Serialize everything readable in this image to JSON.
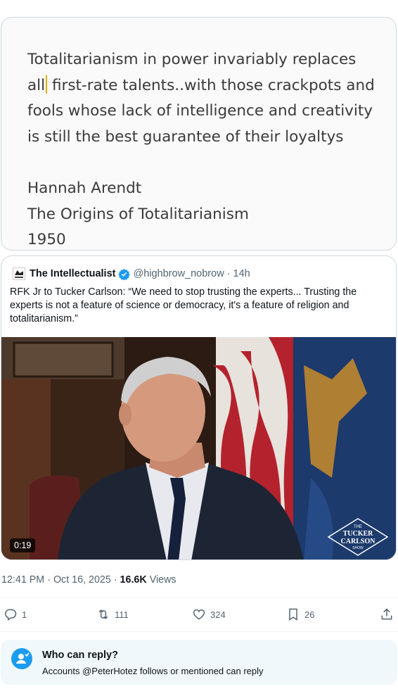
{
  "quote_card": {
    "lines": [
      "Totalitarianism in power invariably replaces",
      "first-rate talents..with those crackpots and",
      "fools whose lack of intelligence and creativity",
      "is still the best guarantee of their loyaltys"
    ],
    "line2_prefix": "all",
    "author": "Hannah Arendt",
    "book": "The Origins of Totalitarianism",
    "year": "1950"
  },
  "quoted_tweet": {
    "name": "The Intellectualist",
    "handle": "@highbrow_nobrow",
    "separator": "·",
    "time": "14h",
    "text": "RFK Jr to Tucker Carlson:  “We need to stop trusting the experts... Trusting the experts is not a feature of science or democracy, it's a feature of religion and totalitarianism.”",
    "video": {
      "duration": "0:19",
      "watermark_lines": [
        "THE",
        "TUCKER",
        "CARLSON",
        "SHOW"
      ]
    }
  },
  "meta": {
    "time": "12:41 PM",
    "separator": "·",
    "date": "Oct 16, 2025",
    "views_count": "16.6K",
    "views_label": "Views"
  },
  "actions": {
    "replies": "1",
    "reposts": "111",
    "likes": "324",
    "bookmarks": "26"
  },
  "reply_settings": {
    "title": "Who can reply?",
    "subtitle": "Accounts @PeterHotez follows or mentioned can reply"
  },
  "colors": {
    "accent": "#1d9bf0",
    "muted": "#536471",
    "text": "#0f1419"
  }
}
